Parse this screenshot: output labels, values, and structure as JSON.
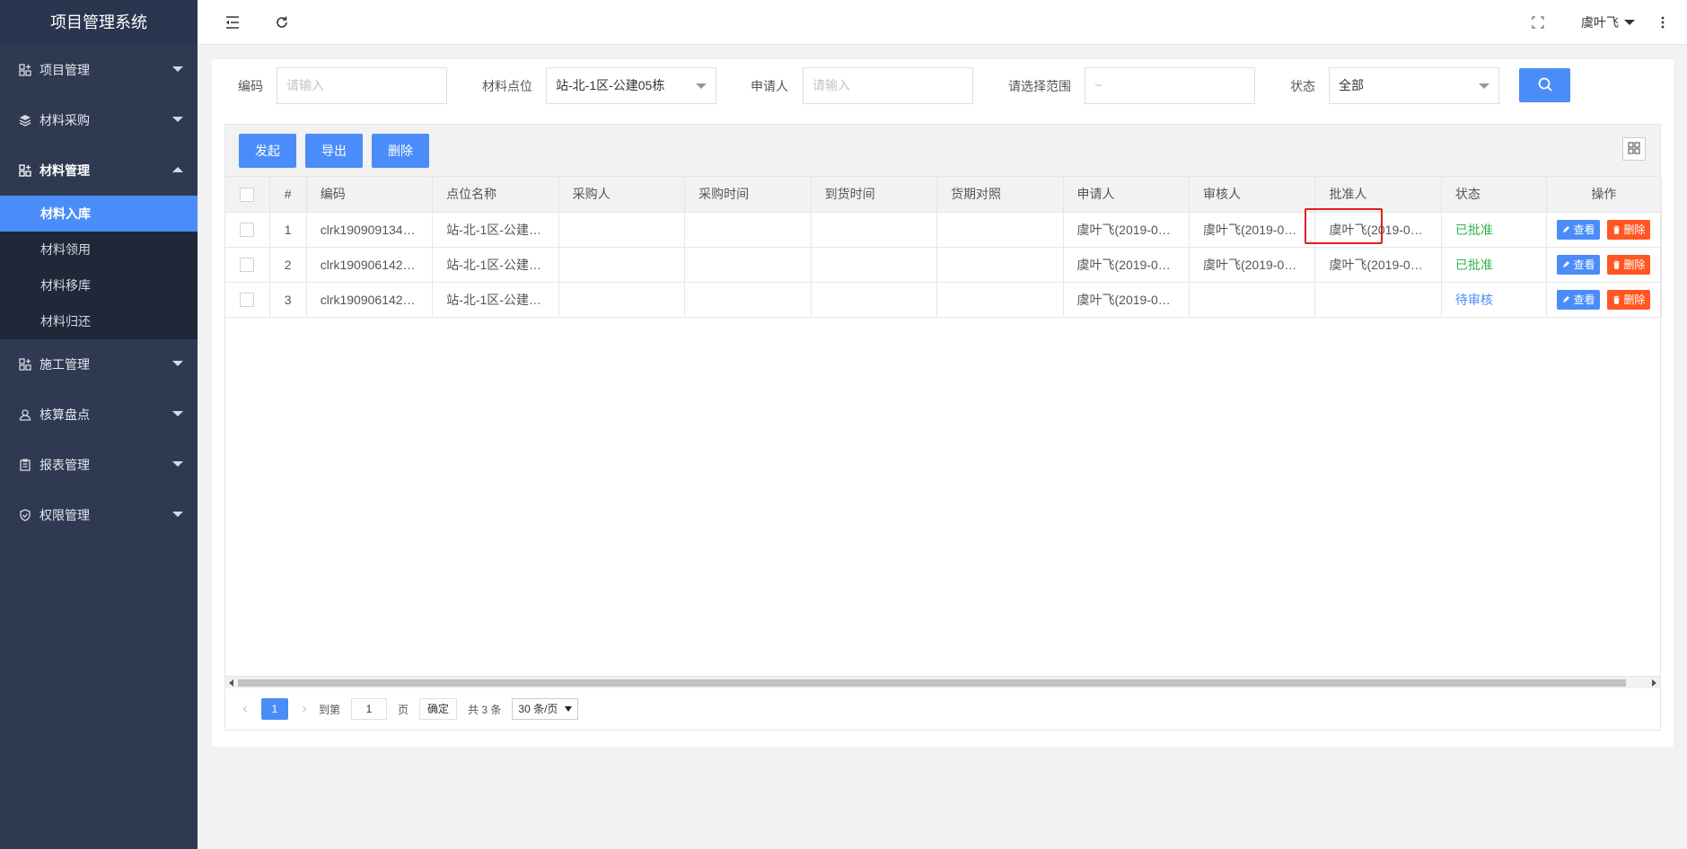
{
  "app": {
    "title": "项目管理系统"
  },
  "sidebar": {
    "items": [
      {
        "label": "项目管理",
        "icon": "grid-plus-icon"
      },
      {
        "label": "材料采购",
        "icon": "layers-icon"
      },
      {
        "label": "材料管理",
        "icon": "grid-plus-icon",
        "open": true,
        "children": [
          {
            "label": "材料入库",
            "active": true
          },
          {
            "label": "材料领用"
          },
          {
            "label": "材料移库"
          },
          {
            "label": "材料归还"
          }
        ]
      },
      {
        "label": "施工管理",
        "icon": "grid-plus-icon"
      },
      {
        "label": "核算盘点",
        "icon": "user-icon"
      },
      {
        "label": "报表管理",
        "icon": "clipboard-icon"
      },
      {
        "label": "权限管理",
        "icon": "shield-icon"
      }
    ]
  },
  "topbar": {
    "user": "虞叶飞"
  },
  "filters": {
    "code_label": "编码",
    "code_placeholder": "请输入",
    "site_label": "材料点位",
    "site_value": "站-北-1区-公建05栋",
    "applicant_label": "申请人",
    "applicant_placeholder": "请输入",
    "range_label": "请选择范围",
    "range_placeholder": "~",
    "status_label": "状态",
    "status_value": "全部"
  },
  "toolbar": {
    "launch": "发起",
    "export": "导出",
    "delete": "删除"
  },
  "table": {
    "headers": [
      "#",
      "编码",
      "点位名称",
      "采购人",
      "采购时间",
      "到货时间",
      "货期对照",
      "申请人",
      "审核人",
      "批准人",
      "状态",
      "操作"
    ],
    "rows": [
      {
        "idx": "1",
        "code": "clrk190909134…",
        "site": "站-北-1区-公建…",
        "buyer": "",
        "buy_time": "",
        "arrive_time": "",
        "compare": "",
        "applicant": "虞叶飞(2019-0…",
        "reviewer": "虞叶飞(2019-0…",
        "approver": "虞叶飞(2019-0…",
        "status": "已批准",
        "status_type": "ok"
      },
      {
        "idx": "2",
        "code": "clrk190906142…",
        "site": "站-北-1区-公建…",
        "buyer": "",
        "buy_time": "",
        "arrive_time": "",
        "compare": "",
        "applicant": "虞叶飞(2019-0…",
        "reviewer": "虞叶飞(2019-0…",
        "approver": "虞叶飞(2019-0…",
        "status": "已批准",
        "status_type": "ok"
      },
      {
        "idx": "3",
        "code": "clrk190906142…",
        "site": "站-北-1区-公建…",
        "buyer": "",
        "buy_time": "",
        "arrive_time": "",
        "compare": "",
        "applicant": "虞叶飞(2019-0…",
        "reviewer": "",
        "approver": "",
        "status": "待审核",
        "status_type": "wait"
      }
    ],
    "view_label": "查看",
    "delete_label": "删除"
  },
  "pager": {
    "current": "1",
    "goto_label": "到第",
    "goto_value": "1",
    "page_label": "页",
    "confirm": "确定",
    "total": "共 3 条",
    "page_size": "30 条/页"
  },
  "colors": {
    "primary": "#4b8df8",
    "danger": "#ff5722",
    "success": "#2fb44f",
    "sidebar": "#2f3a52"
  }
}
